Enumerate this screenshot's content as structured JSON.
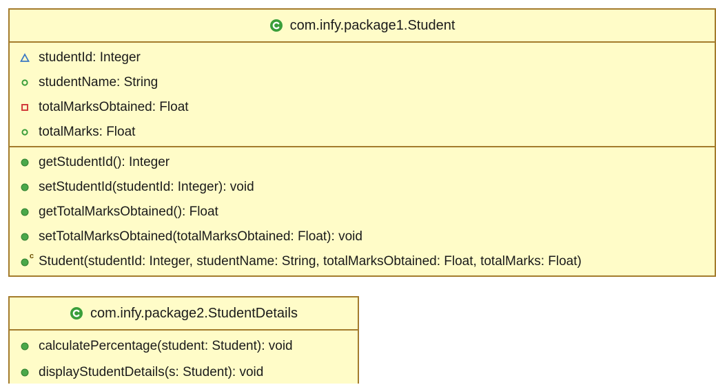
{
  "classes": [
    {
      "name": "com.infy.package1.Student",
      "attributes": [
        {
          "text": "studentId: Integer",
          "visibility": "package"
        },
        {
          "text": "studentName: String",
          "visibility": "public-field"
        },
        {
          "text": "totalMarksObtained: Float",
          "visibility": "private"
        },
        {
          "text": "totalMarks: Float",
          "visibility": "public-field"
        }
      ],
      "operations": [
        {
          "text": "getStudentId(): Integer",
          "visibility": "public"
        },
        {
          "text": "setStudentId(studentId: Integer): void",
          "visibility": "public"
        },
        {
          "text": "getTotalMarksObtained(): Float",
          "visibility": "public"
        },
        {
          "text": "setTotalMarksObtained(totalMarksObtained: Float): void",
          "visibility": "public"
        },
        {
          "text": "Student(studentId: Integer, studentName: String, totalMarksObtained: Float, totalMarks: Float)",
          "visibility": "constructor"
        }
      ]
    },
    {
      "name": "com.infy.package2.StudentDetails",
      "attributes": [],
      "operations": [
        {
          "text": "calculatePercentage(student: Student): void",
          "visibility": "public"
        },
        {
          "text": "displayStudentDetails(s: Student): void",
          "visibility": "public"
        }
      ]
    }
  ],
  "colors": {
    "box_fill": "#fffcc8",
    "box_border": "#a37b2c",
    "class_icon": "#3a9e3a",
    "public_dot": "#4aa84a",
    "package_triangle": "#3b78c4",
    "private_square": "#d23c3c"
  },
  "icons": {
    "class": "class-c-icon",
    "public": "public-method-icon",
    "public-field": "public-field-icon",
    "package": "package-visibility-icon",
    "private": "private-field-icon",
    "constructor": "constructor-icon"
  },
  "constructor_marker": "c"
}
